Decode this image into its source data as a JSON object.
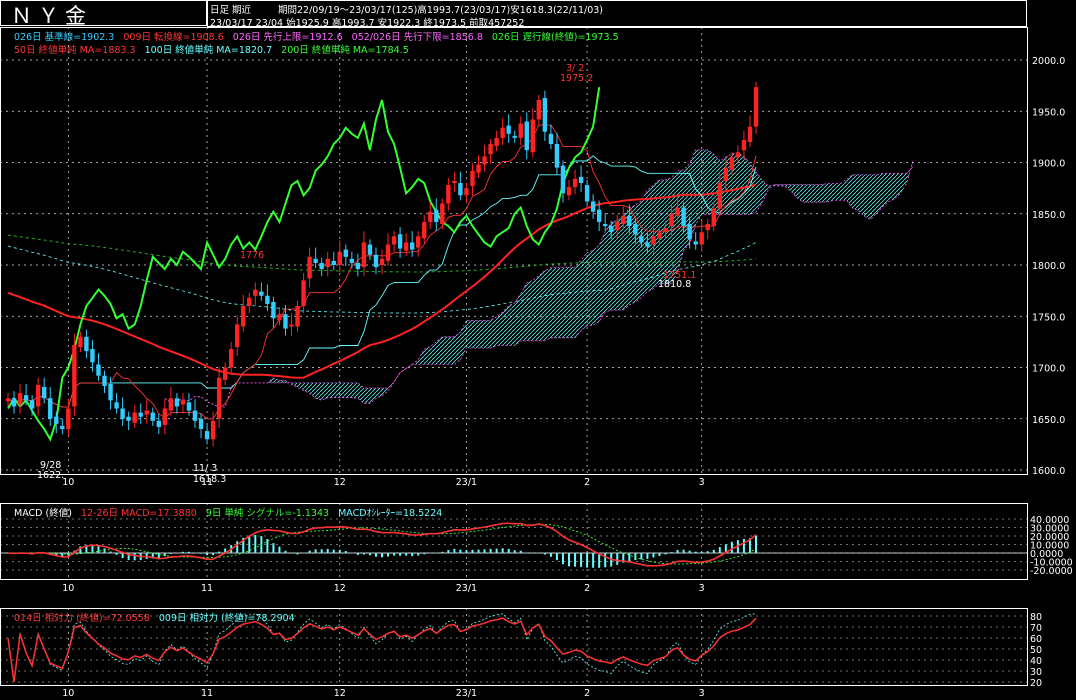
{
  "header": {
    "title": "ＮＹ金",
    "mode": "日足 期近",
    "period_line": "期間22/09/19～23/03/17(125)高1993.7(23/03/17)安1618.3(22/11/03)",
    "ohlc_line": "23/03/17 23/04 始1925.9 高1993.7 安1922.3 終1973.5 前取457252"
  },
  "legend": {
    "row1": [
      {
        "text": "026日 基準線=1902.3",
        "color": "#33ccff"
      },
      {
        "text": "009日 転換線=1908.6",
        "color": "#ff3333"
      },
      {
        "text": "026日 先行上限=1912.6",
        "color": "#ff66ff"
      },
      {
        "text": "052/026日 先行下限=1856.8",
        "color": "#ff66ff"
      },
      {
        "text": "026日 遅行線(終値)=1973.5",
        "color": "#33ff33"
      }
    ],
    "row2": [
      {
        "text": "50日 終値単純 MA=1883.3",
        "color": "#ff3333"
      },
      {
        "text": "100日 終値単純 MA=1820.7",
        "color": "#66ffff"
      },
      {
        "text": "200日 終値単純 MA=1784.5",
        "color": "#33ff33"
      }
    ],
    "macd": [
      {
        "text": "MACD (終値)",
        "color": "#ffffff"
      },
      {
        "text": "12-26日 MACD=17.3880",
        "color": "#ff3333"
      },
      {
        "text": "9日 単純 シグナル=-1.1343",
        "color": "#33ff33"
      },
      {
        "text": "MACDｵｼﾚｰﾀｰ=18.5224",
        "color": "#66ffff"
      }
    ],
    "rsi": [
      {
        "text": "014日 相対力 (終値)=72.0558",
        "color": "#ff3333"
      },
      {
        "text": "009日 相対力 (終値)=78.2904",
        "color": "#66ffff"
      }
    ]
  },
  "annotations": [
    {
      "text": "9/28",
      "color": "#ffffff"
    },
    {
      "text": "1622.",
      "color": "#ffffff"
    },
    {
      "text": "11/ 3",
      "color": "#ffffff"
    },
    {
      "text": "1618.3",
      "color": "#ffffff"
    },
    {
      "text": "3/ 2",
      "color": "#ff3333"
    },
    {
      "text": "1975.2",
      "color": "#ff3333"
    },
    {
      "text": "1810.8",
      "color": "#ffffff"
    },
    {
      "text": "1751.1",
      "color": "#ff3333"
    },
    {
      "text": "1776",
      "color": "#ff3333"
    }
  ],
  "chart_data": [
    {
      "type": "candlestick",
      "name": "price",
      "yticks": [
        1600.0,
        1650.0,
        1700.0,
        1750.0,
        1800.0,
        1850.0,
        1900.0,
        1950.0,
        2000.0
      ],
      "ylim": [
        1600,
        2000
      ],
      "xticks": [
        "10",
        "11",
        "12",
        "23/1",
        "2",
        "3"
      ],
      "close": [
        1670,
        1662,
        1675,
        1668,
        1660,
        1683,
        1670,
        1650,
        1645,
        1640,
        1660,
        1722,
        1730,
        1716,
        1705,
        1692,
        1682,
        1668,
        1660,
        1650,
        1648,
        1656,
        1652,
        1658,
        1648,
        1642,
        1660,
        1670,
        1662,
        1668,
        1658,
        1648,
        1640,
        1630,
        1648,
        1690,
        1700,
        1718,
        1742,
        1760,
        1768,
        1776,
        1770,
        1762,
        1748,
        1752,
        1738,
        1742,
        1760,
        1785,
        1808,
        1802,
        1796,
        1806,
        1800,
        1813,
        1808,
        1802,
        1796,
        1822,
        1810,
        1798,
        1806,
        1820,
        1828,
        1816,
        1822,
        1815,
        1828,
        1842,
        1852,
        1842,
        1860,
        1878,
        1882,
        1868,
        1875,
        1892,
        1898,
        1906,
        1918,
        1924,
        1934,
        1928,
        1924,
        1938,
        1912,
        1942,
        1961,
        1930,
        1918,
        1895,
        1870,
        1876,
        1884,
        1880,
        1862,
        1852,
        1842,
        1838,
        1832,
        1842,
        1848,
        1838,
        1830,
        1822,
        1818,
        1828,
        1832,
        1836,
        1850,
        1856,
        1838,
        1825,
        1820,
        1832,
        1840,
        1855,
        1880,
        1895,
        1905,
        1910,
        1922,
        1935,
        1973.5
      ],
      "sma50_last": 1883.3,
      "sma100_last": 1820.7,
      "sma200_last": 1784.5
    },
    {
      "type": "bar+line",
      "name": "MACD",
      "yticks": [
        "40.0000",
        "30.0000",
        "20.0000",
        "10.0000",
        "0.0000",
        "-10.0000",
        "-20.0000",
        "-30.0000"
      ],
      "ylim": [
        -33,
        42
      ],
      "macd_last": 17.388,
      "signal_last": -1.1343,
      "osc_last": 18.5224
    },
    {
      "type": "line",
      "name": "RSI",
      "yticks": [
        "80",
        "70",
        "60",
        "50",
        "40",
        "30",
        "20"
      ],
      "ylim": [
        18,
        82
      ],
      "rsi14_last": 72.0558,
      "rsi9_last": 78.2904
    }
  ],
  "colors": {
    "up": "#ff2222",
    "down": "#33ccff",
    "tenkan": "#ff3333",
    "kijun": "#66ffff",
    "chikou": "#33ff33",
    "cloud": "#ff55ff",
    "ma50": "#ff2222",
    "ma100": "#66ffff",
    "ma200": "#22aa22",
    "grid": "#dddddd"
  }
}
